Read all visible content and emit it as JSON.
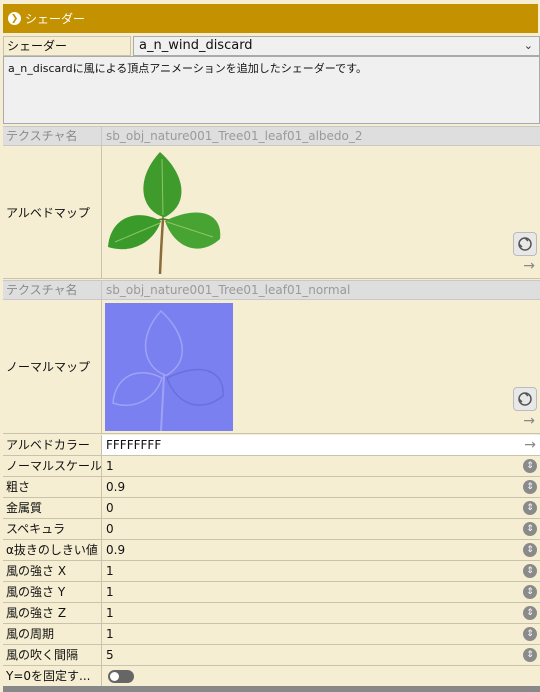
{
  "header": {
    "title": "シェーダー",
    "icon": "chevron-down-icon"
  },
  "shader": {
    "label": "シェーダー",
    "value": "a_n_wind_discard"
  },
  "description": "a_n_discardに風による頂点アニメーションを追加したシェーダーです。",
  "albedo_texture": {
    "name_label": "テクスチャ名",
    "name_value": "sb_obj_nature001_Tree01_leaf01_albedo_2",
    "map_label": "アルベドマップ"
  },
  "normal_texture": {
    "name_label": "テクスチャ名",
    "name_value": "sb_obj_nature001_Tree01_leaf01_normal",
    "map_label": "ノーマルマップ"
  },
  "properties": [
    {
      "label": "アルベドカラー",
      "value": "FFFFFFFF",
      "control": "arrow"
    },
    {
      "label": "ノーマルスケール",
      "value": "1",
      "control": "stepper"
    },
    {
      "label": "粗さ",
      "value": "0.9",
      "control": "stepper"
    },
    {
      "label": "金属質",
      "value": "0",
      "control": "stepper"
    },
    {
      "label": "スペキュラ",
      "value": "0",
      "control": "stepper"
    },
    {
      "label": "α抜きのしきい値",
      "value": "0.9",
      "control": "stepper"
    },
    {
      "label": "風の強さ X",
      "value": "1",
      "control": "stepper"
    },
    {
      "label": "風の強さ Y",
      "value": "1",
      "control": "stepper"
    },
    {
      "label": "風の強さ Z",
      "value": "1",
      "control": "stepper"
    },
    {
      "label": "風の周期",
      "value": "1",
      "control": "stepper"
    },
    {
      "label": "風の吹く間隔",
      "value": "5",
      "control": "stepper"
    },
    {
      "label": "Y=0を固定す...",
      "value": false,
      "control": "toggle"
    }
  ],
  "colors": {
    "header": "#c49200",
    "panel": "#f5eed3",
    "normal_map": "#7b80f0"
  }
}
